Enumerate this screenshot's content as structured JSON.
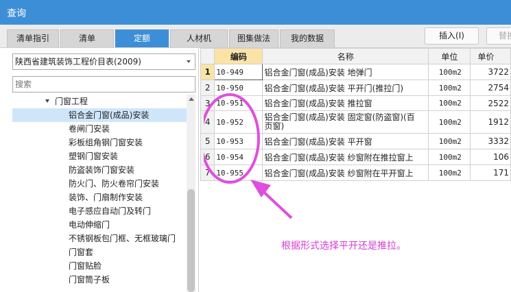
{
  "window": {
    "title": "查询"
  },
  "tabs": [
    {
      "label": "清单指引",
      "active": false
    },
    {
      "label": "清单",
      "active": false
    },
    {
      "label": "定额",
      "active": true
    },
    {
      "label": "人材机",
      "active": false
    },
    {
      "label": "图集做法",
      "active": false
    },
    {
      "label": "我的数据",
      "active": false
    }
  ],
  "buttons": {
    "insert": "插入(I)",
    "replace": "替换"
  },
  "left": {
    "selector_value": "陕西省建筑装饰工程价目表(2009)",
    "search_placeholder": "搜索",
    "tree": [
      {
        "label": "门窗工程",
        "selected": false
      },
      {
        "label": "铝合金门窗(成品)安装",
        "selected": true
      },
      {
        "label": "卷闸门安装",
        "selected": false
      },
      {
        "label": "彩板组角钢门窗安装",
        "selected": false
      },
      {
        "label": "塑钢门窗安装",
        "selected": false
      },
      {
        "label": "防盗装饰门窗安装",
        "selected": false
      },
      {
        "label": "防火门、防火卷帘门安装",
        "selected": false
      },
      {
        "label": "装饰、门扇制作安装",
        "selected": false
      },
      {
        "label": "电子感应自动门及转门",
        "selected": false
      },
      {
        "label": "电动伸缩门",
        "selected": false
      },
      {
        "label": "不锈钢板包门框、无框玻璃门",
        "selected": false
      },
      {
        "label": "门窗套",
        "selected": false
      },
      {
        "label": "门窗贴脸",
        "selected": false
      },
      {
        "label": "门窗筒子板",
        "selected": false
      }
    ]
  },
  "table": {
    "columns": [
      "",
      "编码",
      "名称",
      "单位",
      "单价"
    ],
    "rows": [
      {
        "num": "1",
        "code": "10-949",
        "name": "铝合金门窗(成品)安装 地弹门",
        "unit": "100m2",
        "price": "3722"
      },
      {
        "num": "2",
        "code": "10-950",
        "name": "铝合金门窗(成品)安装 平开门(推拉门)",
        "unit": "100m2",
        "price": "2754"
      },
      {
        "num": "3",
        "code": "10-951",
        "name": "铝合金门窗(成品)安装 推拉窗",
        "unit": "100m2",
        "price": "2522"
      },
      {
        "num": "4",
        "code": "10-952",
        "name": "铝合金门窗(成品)安装 固定窗(防盗窗)(百",
        "name2": "页窗)",
        "unit": "100m2",
        "price": "1912"
      },
      {
        "num": "5",
        "code": "10-953",
        "name": "铝合金门窗(成品)安装 平开窗",
        "unit": "100m2",
        "price": "3332"
      },
      {
        "num": "6",
        "code": "10-954",
        "name": "铝合金门窗(成品)安装 纱窗附在推拉窗上",
        "unit": "100m2",
        "price": "106"
      },
      {
        "num": "7",
        "code": "10-955",
        "name": "铝合金门窗(成品)安装 纱窗附在平开窗上",
        "unit": "100m2",
        "price": "171"
      }
    ]
  },
  "annotation": {
    "text": "根据形式选择平开还是推拉。",
    "color": "#d63cd0"
  }
}
